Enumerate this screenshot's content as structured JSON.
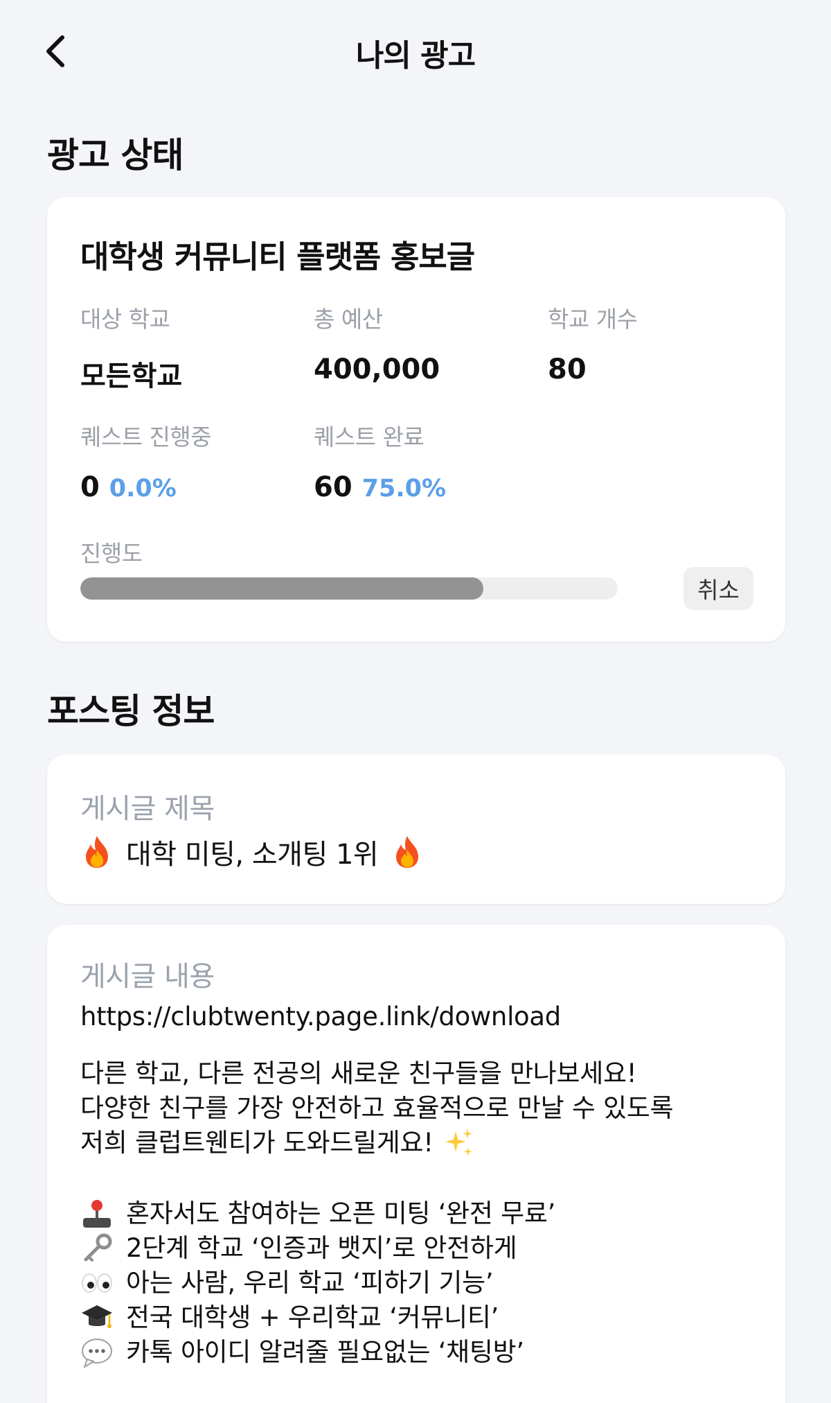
{
  "header": {
    "title": "나의 광고",
    "back_icon": "chevron-left-icon"
  },
  "ad_status": {
    "section_title": "광고 상태",
    "ad_title": "대학생 커뮤니티 플랫폼 홍보글",
    "target_school_label": "대상 학교",
    "target_school_value": "모든학교",
    "total_budget_label": "총 예산",
    "total_budget_value": "400,000",
    "school_count_label": "학교 개수",
    "school_count_value": "80",
    "quest_in_progress_label": "퀘스트 진행중",
    "quest_in_progress_value": "0",
    "quest_in_progress_pct": "0.0%",
    "quest_done_label": "퀘스트 완료",
    "quest_done_value": "60",
    "quest_done_pct": "75.0%",
    "progress_label": "진행도",
    "progress_fraction": 0.75,
    "cancel_label": "취소",
    "accent_color": "#5B9FE8"
  },
  "posting_info": {
    "section_title": "포스팅 정보",
    "title_label": "게시글 제목",
    "post_title": "대학 미팅, 소개팅 1위",
    "title_icons": [
      "fire-icon",
      "fire-icon"
    ],
    "content_label": "게시글 내용",
    "link": "https://clubtwenty.page.link/download",
    "intro_lines": [
      "다른 학교, 다른 전공의 새로운 친구들을 만나보세요!",
      "다양한 친구를 가장 안전하고 효율적으로 만날 수 있도록",
      "저희 클럽트웬티가 도와드릴게요!"
    ],
    "intro_icon": "sparkles-icon",
    "features": [
      {
        "icon": "joystick-icon",
        "text": "혼자서도 참여하는 오픈 미팅 ‘완전 무료’"
      },
      {
        "icon": "key-icon",
        "text": "2단계 학교 ‘인증과 뱃지’로 안전하게"
      },
      {
        "icon": "eyes-icon",
        "text": "아는 사람, 우리 학교 ‘피하기 기능’"
      },
      {
        "icon": "graduation-cap-icon",
        "text": "전국 대학생 + 우리학교 ‘커뮤니티’"
      },
      {
        "icon": "speech-bubble-icon",
        "text": "카톡 아이디 알려줄 필요없는 ‘채팅방’"
      }
    ]
  }
}
